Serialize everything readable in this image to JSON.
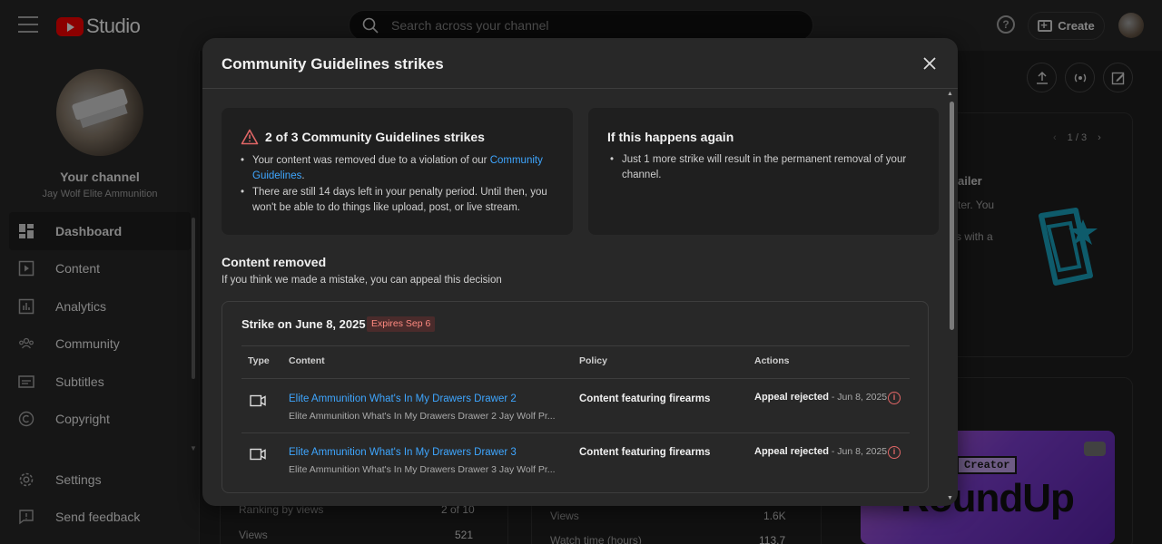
{
  "topbar": {
    "logo_text": "Studio",
    "search_placeholder": "Search across your channel",
    "help": "?",
    "create_label": "Create"
  },
  "sidebar": {
    "channel_title": "Your channel",
    "channel_name": "Jay Wolf Elite Ammunition",
    "items": [
      {
        "label": "Dashboard",
        "icon": "dashboard-icon"
      },
      {
        "label": "Content",
        "icon": "content-icon"
      },
      {
        "label": "Analytics",
        "icon": "analytics-icon"
      },
      {
        "label": "Community",
        "icon": "community-icon"
      },
      {
        "label": "Subtitles",
        "icon": "subtitles-icon"
      },
      {
        "label": "Copyright",
        "icon": "copyright-icon"
      }
    ],
    "bottom_items": [
      {
        "label": "Settings",
        "icon": "gear-icon"
      },
      {
        "label": "Send feedback",
        "icon": "feedback-icon"
      }
    ]
  },
  "background": {
    "pager": "1 / 3",
    "card_text_1": "ailer",
    "card_text_2": "atter. You",
    "card_text_3": "s with a",
    "thumb_badge": "Creator",
    "thumb_title": "RoundUp",
    "row_ranking_label": "Ranking by views",
    "row_ranking_value": "2 of 10",
    "row_views_label": "Views",
    "row_views_value": "521",
    "row2_views_label": "Views",
    "row2_views_value": "1.6K",
    "row2_watch_label": "Watch time (hours)",
    "row2_watch_value": "113.7"
  },
  "modal": {
    "title": "Community Guidelines strikes",
    "strikes_box": {
      "title": "2 of 3 Community Guidelines strikes",
      "bullet1_text": "Your content was removed due to a violation of our ",
      "bullet1_link": "Community Guidelines",
      "bullet1_end": ".",
      "bullet2": "There are still 14 days left in your penalty period. Until then, you won't be able to do things like upload, post, or live stream."
    },
    "again_box": {
      "title": "If this happens again",
      "bullet1": "Just 1 more strike will result in the permanent removal of your channel."
    },
    "content_removed": {
      "title": "Content removed",
      "subtitle": "If you think we made a mistake, you can appeal this decision"
    },
    "strike_card": {
      "title": "Strike on June 8, 2025",
      "badge": "Expires Sep 6",
      "headers": {
        "type": "Type",
        "content": "Content",
        "policy": "Policy",
        "actions": "Actions"
      },
      "rows": [
        {
          "title": "Elite Ammunition What's In My Drawers Drawer 2",
          "description": "Elite Ammunition What's In My Drawers Drawer 2 Jay Wolf Pr...",
          "policy": "Content featuring firearms",
          "action": "Appeal rejected",
          "date": " - Jun 8, 2025"
        },
        {
          "title": "Elite Ammunition What's In My Drawers Drawer 3",
          "description": "Elite Ammunition What's In My Drawers Drawer 3 Jay Wolf Pr...",
          "policy": "Content featuring firearms",
          "action": "Appeal rejected",
          "date": " - Jun 8, 2025"
        }
      ]
    }
  },
  "colors": {
    "accent_link": "#3ea6ff",
    "warning": "#e06666",
    "badge_text": "#ff8a80"
  }
}
